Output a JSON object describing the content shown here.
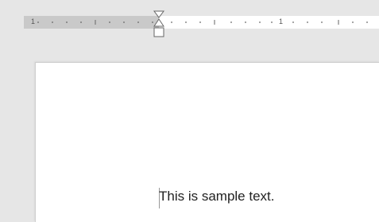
{
  "ruler": {
    "numbers": [
      "1",
      "1"
    ]
  },
  "document": {
    "text": "This is sample text."
  }
}
